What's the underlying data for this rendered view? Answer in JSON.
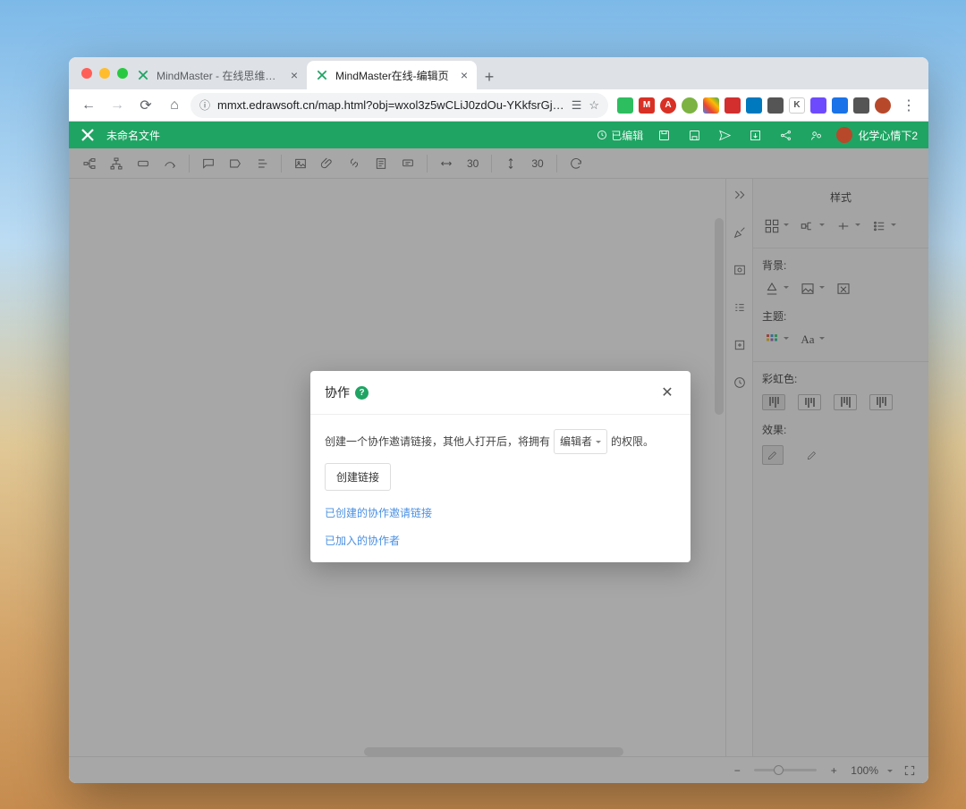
{
  "browser": {
    "tabs": [
      {
        "title": "MindMaster - 在线思维导图",
        "active": false
      },
      {
        "title": "MindMaster在线-编辑页",
        "active": true
      }
    ],
    "url_display": "mmxt.edrawsoft.cn/map.html?obj=wxol3z5wCLiJ0zdOu-YKkfsrGjmkk…"
  },
  "app": {
    "file_name": "未命名文件",
    "status_text": "已编辑",
    "user_name": "化学心情下2",
    "toolbar": {
      "width_value": "30",
      "height_value": "30"
    },
    "side_panel": {
      "title": "样式",
      "section_background": "背景:",
      "section_theme": "主题:",
      "section_rainbow": "彩虹色:",
      "section_effect": "效果:",
      "font_label": "Aa"
    },
    "footer": {
      "zoom_text": "100%"
    }
  },
  "modal": {
    "title": "协作",
    "desc_prefix": "创建一个协作邀请链接，其他人打开后，将拥有",
    "role_selected": "编辑者",
    "desc_suffix": "的权限。",
    "create_button": "创建链接",
    "link_created": "已创建的协作邀请链接",
    "link_members": "已加入的协作者"
  }
}
